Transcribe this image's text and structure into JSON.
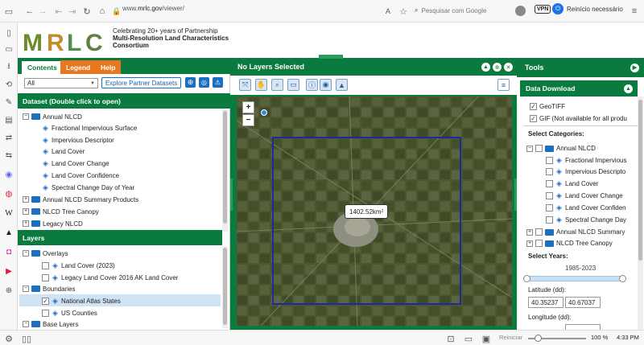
{
  "browser": {
    "url_prefix": "www.",
    "url_domain": "mrlc.gov",
    "url_path": "/viewer/",
    "search_placeholder": "Pesquisar com Google",
    "vpn_label": "VPN",
    "restart_label": "Reinício necessário"
  },
  "header": {
    "logo_letters": [
      "M",
      "R",
      "L",
      "C"
    ],
    "tagline_1": "Celebrating 20+ years of Partnership",
    "tagline_2": "Multi-Resolution Land Characteristics",
    "tagline_3": "Consortium"
  },
  "left_panel": {
    "tabs": [
      "Contents",
      "Legend",
      "Help"
    ],
    "filter_value": "All",
    "explore_button": "Explore Partner Datasets",
    "dataset_header": "Dataset (Double click to open)",
    "dataset_tree": [
      {
        "label": "Annual NLCD",
        "type": "folder",
        "expanded": true
      },
      {
        "label": "Fractional Impervious Surface",
        "type": "layer"
      },
      {
        "label": "Impervious Descriptor",
        "type": "layer"
      },
      {
        "label": "Land Cover",
        "type": "layer"
      },
      {
        "label": "Land Cover Change",
        "type": "layer"
      },
      {
        "label": "Land Cover Confidence",
        "type": "layer"
      },
      {
        "label": "Spectral Change Day of Year",
        "type": "layer"
      },
      {
        "label": "Annual NLCD Summary Products",
        "type": "folder",
        "expanded": false
      },
      {
        "label": "NLCD Tree Canopy",
        "type": "folder",
        "expanded": false
      },
      {
        "label": "Legacy NLCD",
        "type": "folder",
        "expanded": false
      }
    ],
    "layers_header": "Layers",
    "layers_tree": [
      {
        "label": "Overlays",
        "type": "folder"
      },
      {
        "label": "Land Cover (2023)",
        "type": "layer"
      },
      {
        "label": "Legacy Land Cover 2016 AK Land Cover",
        "type": "layer"
      },
      {
        "label": "Boundaries",
        "type": "folder"
      },
      {
        "label": "National Atlas States",
        "type": "layer",
        "checked": true
      },
      {
        "label": "US Counties",
        "type": "layer"
      },
      {
        "label": "Base Layers",
        "type": "folder"
      }
    ]
  },
  "map_panel": {
    "title": "No Layers Selected",
    "zoom_in": "+",
    "zoom_out": "−",
    "area_label": "1402.52km",
    "area_unit_sup": "2"
  },
  "right_panel": {
    "tools_title": "Tools",
    "data_download_title": "Data Download",
    "formats": [
      {
        "label": "GeoTIFF",
        "checked": true
      },
      {
        "label": "GIF (Not available for all produ",
        "checked": true
      }
    ],
    "select_categories_label": "Select Categories:",
    "categories": [
      {
        "label": "Annual NLCD",
        "type": "folder"
      },
      {
        "label": "Fractional Impervious",
        "type": "layer"
      },
      {
        "label": "Impervious Descripto",
        "type": "layer"
      },
      {
        "label": "Land Cover",
        "type": "layer"
      },
      {
        "label": "Land Cover Change",
        "type": "layer"
      },
      {
        "label": "Land Cover Confiden",
        "type": "layer"
      },
      {
        "label": "Spectral Change Day",
        "type": "layer"
      },
      {
        "label": "Annual NLCD Summary",
        "type": "folder"
      },
      {
        "label": "NLCD Tree Canopy",
        "type": "folder"
      }
    ],
    "select_years_label": "Select Years:",
    "years_range": "1985-2023",
    "latitude_label": "Latitude (dd):",
    "latitude_values": [
      "40.35237",
      "40.67037"
    ],
    "longitude_label": "Longitude (dd):"
  },
  "status_bar": {
    "reset_label": "Reiniciar",
    "zoom_level": "100 %",
    "time": "4:33 PM"
  }
}
